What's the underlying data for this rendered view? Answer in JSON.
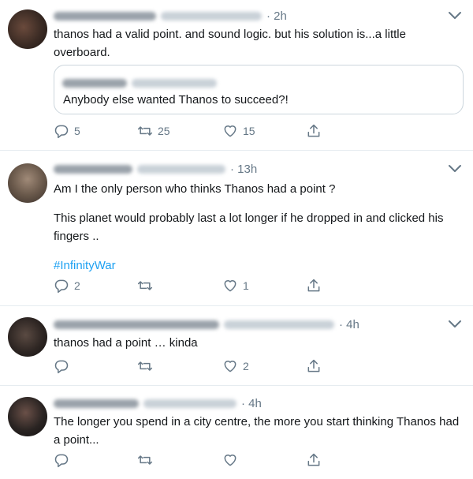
{
  "tweets": [
    {
      "time": "· 2h",
      "text": [
        "thanos had a valid point. and sound logic. but his solution is...a little overboard."
      ],
      "quote": {
        "text": "Anybody else wanted Thanos to succeed?!"
      },
      "actions": {
        "reply": "5",
        "retweet": "25",
        "like": "15"
      },
      "avatar_color": "#3b2b24"
    },
    {
      "time": "· 13h",
      "text": [
        "Am I the only person who thinks Thanos had a point ?",
        "This planet would probably last a lot longer if he dropped in and clicked his fingers .."
      ],
      "hashtag": "#InfinityWar",
      "actions": {
        "reply": "2",
        "retweet": "",
        "like": "1"
      },
      "avatar_color": "#6b5a4c"
    },
    {
      "time": "· 4h",
      "text": [
        "thanos had a point … kinda"
      ],
      "actions": {
        "reply": "",
        "retweet": "",
        "like": "2"
      },
      "avatar_color": "#2e2623"
    },
    {
      "time": "· 4h",
      "text": [
        "The longer you spend in a city centre, the more you start thinking Thanos had a point..."
      ],
      "actions": {
        "reply": "",
        "retweet": "",
        "like": ""
      },
      "avatar_color": "#2a2422"
    }
  ],
  "colors": {
    "text": "#14171a",
    "muted": "#657786",
    "link": "#1da1f2",
    "border": "#e6ecf0"
  },
  "icons": {
    "reply": "reply-icon",
    "retweet": "retweet-icon",
    "like": "like-icon",
    "share": "share-icon",
    "more": "chevron-down-icon"
  }
}
